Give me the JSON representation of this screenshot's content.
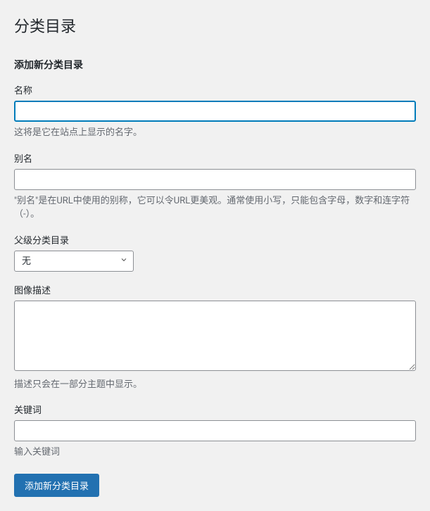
{
  "page": {
    "title": "分类目录"
  },
  "form": {
    "title": "添加新分类目录",
    "name": {
      "label": "名称",
      "value": "",
      "help": "这将是它在站点上显示的名字。"
    },
    "slug": {
      "label": "别名",
      "value": "",
      "help": "\"别名\"是在URL中使用的别称，它可以令URL更美观。通常使用小写，只能包含字母，数字和连字符（-）。"
    },
    "parent": {
      "label": "父级分类目录",
      "selected": "无"
    },
    "description": {
      "label": "图像描述",
      "value": "",
      "help": "描述只会在一部分主题中显示。"
    },
    "keywords": {
      "label": "关键词",
      "value": "",
      "help": "输入关键词"
    },
    "submit": {
      "label": "添加新分类目录"
    }
  }
}
